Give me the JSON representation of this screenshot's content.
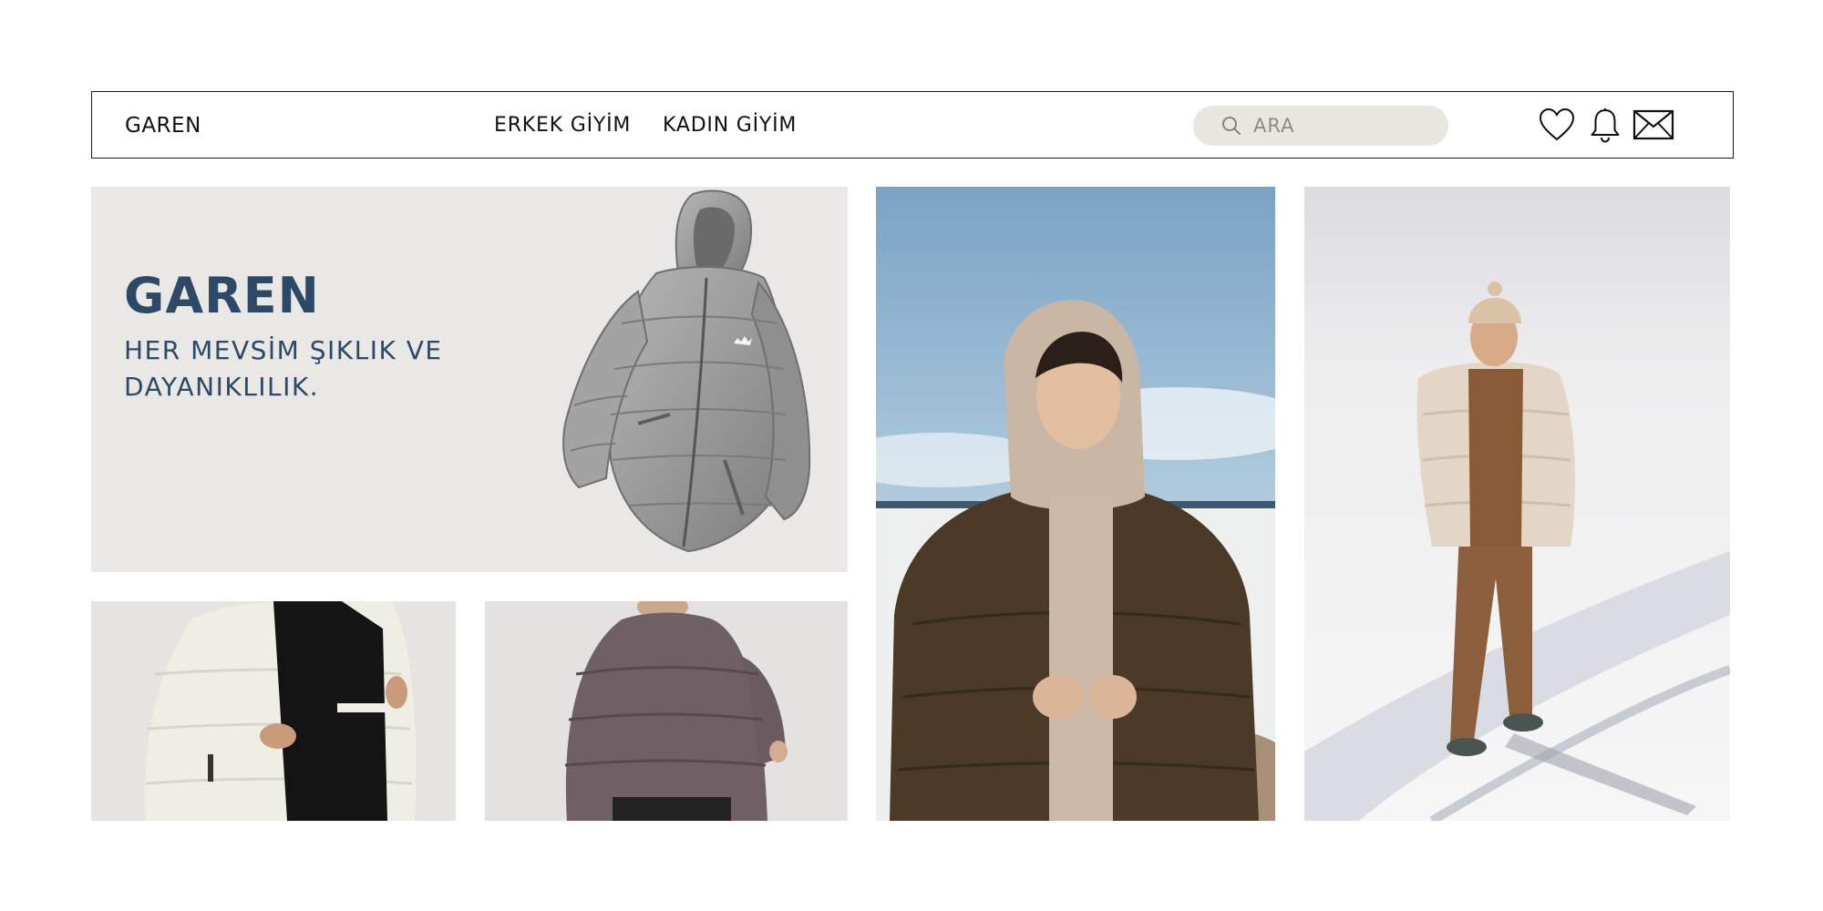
{
  "header": {
    "brand": "GAREN",
    "nav": [
      {
        "label": "ERKEK GİYİM"
      },
      {
        "label": "KADIN GİYİM"
      }
    ],
    "search": {
      "placeholder": "ARA",
      "value": ""
    },
    "icons": [
      "search-icon",
      "heart-icon",
      "bell-icon",
      "mail-icon"
    ]
  },
  "hero": {
    "title": "GAREN",
    "subtitle": "HER MEVSİM ŞIKLIK VE DAYANIKLILIK."
  },
  "colors": {
    "accent": "#2c4968",
    "hero_bg": "#e9e8e4",
    "search_bg": "#e8e6e1",
    "border": "#1a1a1a"
  }
}
